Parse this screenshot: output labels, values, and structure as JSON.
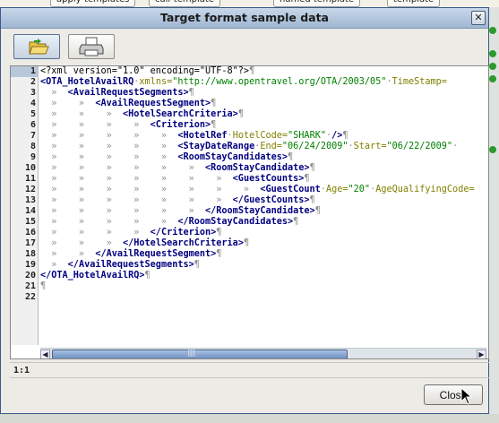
{
  "background": {
    "chips": [
      "apply-templates",
      "call-template",
      "named template",
      "template"
    ]
  },
  "dialog": {
    "title": "Target format sample data",
    "close_icon": "close-x-icon"
  },
  "toolbar": {
    "open_icon": "folder-open-icon",
    "print_icon": "printer-icon"
  },
  "editor": {
    "line_numbers": [
      "1",
      "2",
      "3",
      "4",
      "5",
      "6",
      "7",
      "8",
      "9",
      "10",
      "11",
      "12",
      "13",
      "14",
      "15",
      "16",
      "17",
      "18",
      "19",
      "20",
      "21",
      "22"
    ],
    "current_line": 1,
    "pilcrow": "¶"
  },
  "status": {
    "position": "1:1"
  },
  "buttons": {
    "close": "Close"
  },
  "colors": {
    "tag": "#000080",
    "attr": "#808000",
    "value": "#008000",
    "whitespace": "#909090"
  }
}
